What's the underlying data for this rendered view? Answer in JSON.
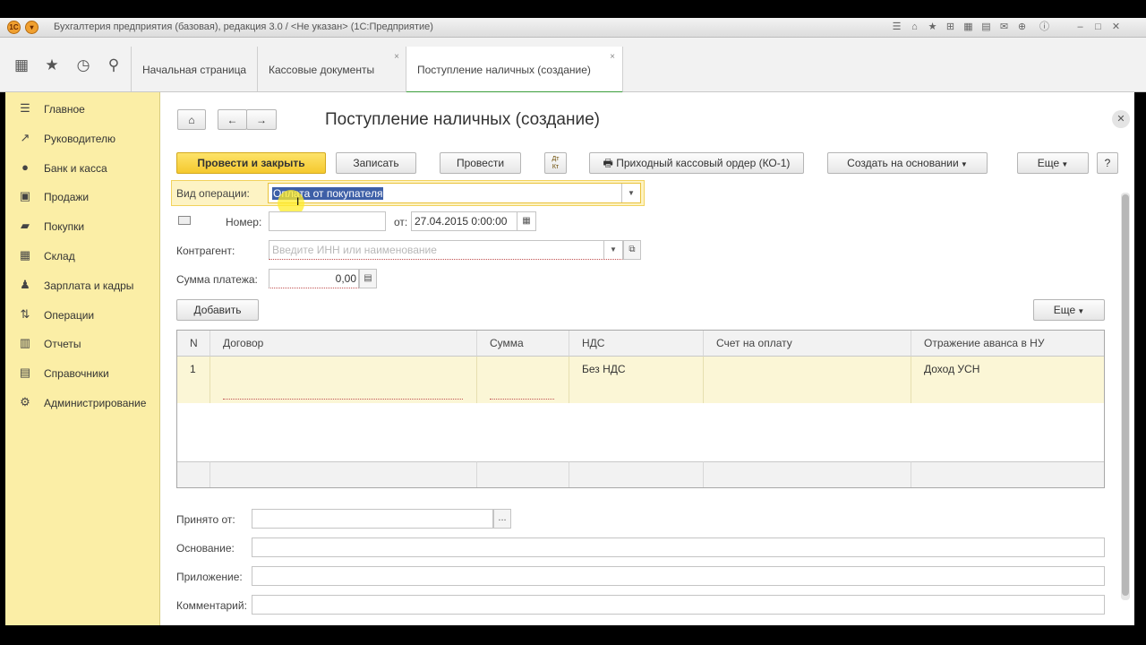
{
  "window": {
    "title": "Бухгалтерия предприятия (базовая), редакция 3.0 / <Не указан>  (1С:Предприятие)",
    "logo_text": "1С"
  },
  "tabs": [
    {
      "label": "Начальная страница"
    },
    {
      "label": "Кассовые документы"
    },
    {
      "label": "Поступление наличных (создание)"
    }
  ],
  "sidebar": {
    "items": [
      {
        "label": "Главное",
        "icon": "menu-lines-icon"
      },
      {
        "label": "Руководителю",
        "icon": "trend-icon"
      },
      {
        "label": "Банк и касса",
        "icon": "coin-icon"
      },
      {
        "label": "Продажи",
        "icon": "bag-icon"
      },
      {
        "label": "Покупки",
        "icon": "cart-icon"
      },
      {
        "label": "Склад",
        "icon": "warehouse-icon"
      },
      {
        "label": "Зарплата и кадры",
        "icon": "person-icon"
      },
      {
        "label": "Операции",
        "icon": "operations-icon"
      },
      {
        "label": "Отчеты",
        "icon": "bar-chart-icon"
      },
      {
        "label": "Справочники",
        "icon": "book-icon"
      },
      {
        "label": "Администрирование",
        "icon": "gear-icon"
      }
    ]
  },
  "form": {
    "title": "Поступление наличных (создание)",
    "toolbar": {
      "post_close": "Провести и закрыть",
      "save": "Записать",
      "post": "Провести",
      "dt_kt": "Дт\nКт",
      "print_order": "Приходный кассовый ордер (КО-1)",
      "create_based": "Создать на основании",
      "more": "Еще",
      "help": "?"
    },
    "operation_label": "Вид операции:",
    "operation_value": "Оплата от покупателя",
    "number_label": "Номер:",
    "number_value": "",
    "date_label": "от:",
    "date_value": "27.04.2015  0:00:00",
    "counterparty_label": "Контрагент:",
    "counterparty_placeholder": "Введите ИНН или наименование",
    "amount_label": "Сумма платежа:",
    "amount_value": "0,00",
    "add_button": "Добавить",
    "table_more": "Еще",
    "table": {
      "columns": [
        "N",
        "Договор",
        "Сумма",
        "НДС",
        "Счет на оплату",
        "Отражение аванса в НУ"
      ],
      "rows": [
        {
          "n": "1",
          "contract": "",
          "amount": "",
          "vat": "Без НДС",
          "invoice": "",
          "advance": "Доход УСН"
        }
      ]
    },
    "received_from_label": "Принято от:",
    "received_from_value": "",
    "basis_label": "Основание:",
    "basis_value": "",
    "attachment_label": "Приложение:",
    "attachment_value": "",
    "comment_label": "Комментарий:",
    "comment_value": ""
  },
  "colors": {
    "sidebar_bg": "#fbeea6",
    "primary_button": "#f5c92e",
    "row_highlight": "#fbf6d6",
    "active_tab_underline": "#3a9e3a"
  }
}
